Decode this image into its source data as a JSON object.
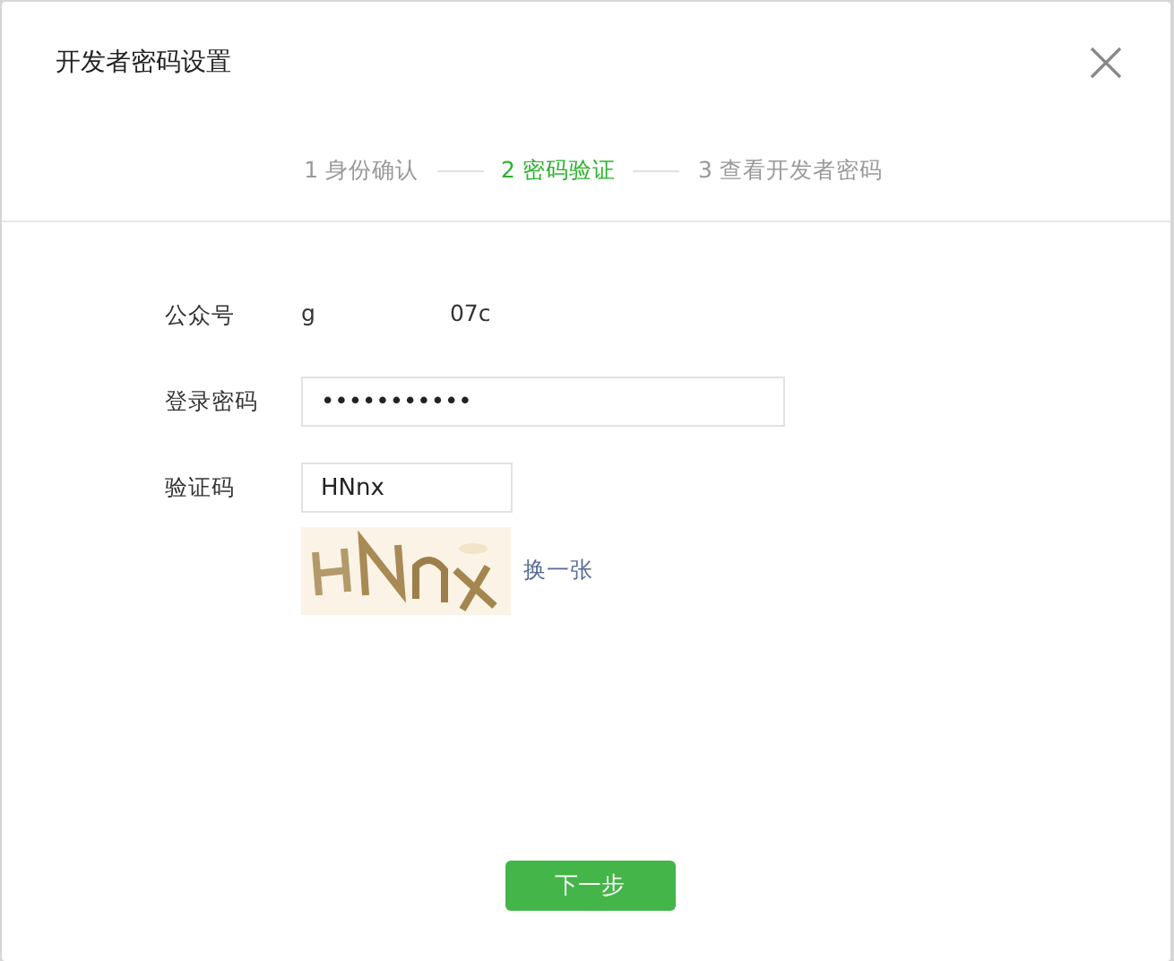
{
  "dialog": {
    "title": "开发者密码设置"
  },
  "steps": [
    {
      "label": "1 身份确认",
      "selected": false
    },
    {
      "label": "2 密码验证",
      "selected": true
    },
    {
      "label": "3 查看开发者密码",
      "selected": false
    }
  ],
  "form": {
    "account": {
      "label": "公众号",
      "value_start": "g",
      "value_end": "07c"
    },
    "password": {
      "label": "登录密码",
      "value": "•••••••••••"
    },
    "captcha": {
      "label": "验证码",
      "value": "HNnx",
      "refresh": "换一张"
    }
  },
  "next_button": "下一步"
}
